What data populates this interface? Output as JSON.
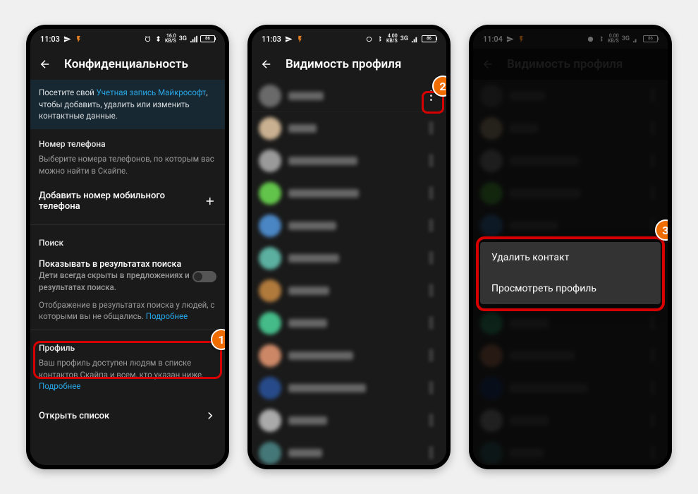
{
  "status_bar": {
    "time_1": "11:03",
    "time_2": "11:04",
    "kb_up": "0.00",
    "kb_dn": "16.0",
    "kb_unit": "KB/S",
    "net": "3G",
    "batt": "86"
  },
  "screen1": {
    "title": "Конфиденциальность",
    "banner_pre": "Посетите свой ",
    "banner_link": "Учетная запись Майкрософт",
    "banner_post": ", чтобы добавить, удалить или изменить контактные данные.",
    "phone_section": {
      "title": "Номер телефона",
      "desc": "Выберите номера телефонов, по которым вас можно найти в Скайпе.",
      "add_label": "Добавить номер мобильного телефона"
    },
    "search_section": {
      "title": "Поиск",
      "row_title": "Показывать в результатах поиска",
      "row_desc": "Дети всегда скрыты в предложениях и результатах поиска.",
      "sub_desc": "Отображение в результатах поиска у людей, с которыми вы не общались.",
      "sub_link": "Подробнее"
    },
    "profile_section": {
      "title": "Профиль",
      "desc": "Ваш профиль доступен людям в списке контактов Скайпа и всем, кто указан ниже.",
      "desc_link": "Подробнее",
      "open_list": "Открыть список"
    }
  },
  "screen2": {
    "title": "Видимость профиля",
    "contacts_avatars": [
      "#6a6a6a",
      "#c9b090",
      "#9a9a9a",
      "#62c44a",
      "#4a86c4",
      "#5bb0a0",
      "#b07a3c",
      "#4b8",
      "#c86",
      "#274b8a",
      "#aaa",
      "#477"
    ],
    "name_widths": [
      50,
      40,
      98,
      100,
      68,
      72,
      58,
      55,
      92,
      110,
      55,
      48
    ]
  },
  "screen3": {
    "title": "Видимость профиля",
    "popup": {
      "delete": "Удалить контакт",
      "view": "Просмотреть профиль"
    }
  },
  "callouts": {
    "n1": "1",
    "n2": "2",
    "n3": "3"
  }
}
